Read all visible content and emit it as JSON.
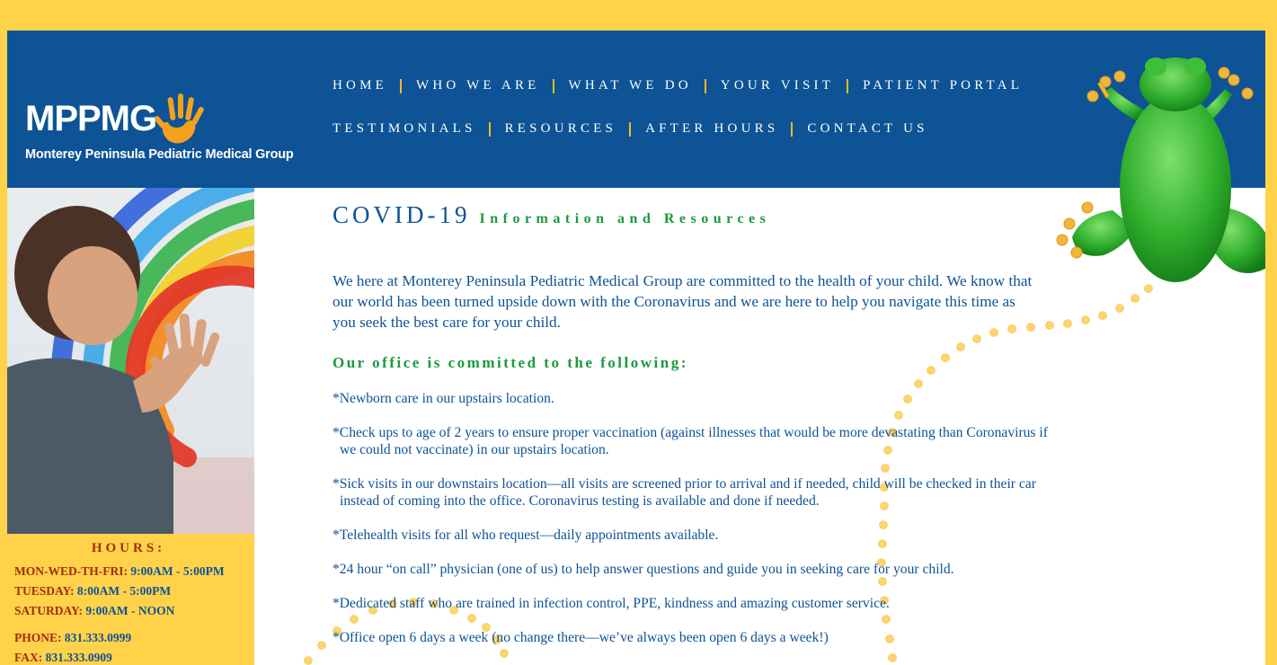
{
  "brand": {
    "logo_text": "MPPMG",
    "name": "Monterey Peninsula Pediatric Medical Group"
  },
  "nav": {
    "row1": [
      "HOME",
      "WHO WE ARE",
      "WHAT WE DO",
      "YOUR VISIT",
      "PATIENT PORTAL"
    ],
    "row2": [
      "TESTIMONIALS",
      "RESOURCES",
      "AFTER HOURS",
      "CONTACT US"
    ]
  },
  "hours": {
    "title": "HOURS:",
    "rows": [
      {
        "label": "MON-WED-TH-FRI:",
        "value": "9:00AM - 5:00PM"
      },
      {
        "label": "TUESDAY:",
        "value": "8:00AM - 5:00PM"
      },
      {
        "label": "SATURDAY:",
        "value": "9:00AM - NOON"
      }
    ],
    "phone_label": "PHONE:",
    "phone": "831.333.0999",
    "fax_label": "FAX:",
    "fax": "831.333.0909"
  },
  "content": {
    "heading_main": "COVID-19",
    "heading_sub": "Information and Resources",
    "intro": "We here at Monterey Peninsula Pediatric Medical Group are committed to the health of your child. We know that our world has been turned upside down with the Coronavirus and we are here to help you navigate this time as you seek the best care for your child.",
    "committed_heading": "Our office is committed to the following:",
    "items": [
      {
        "line1": "*Newborn care in our upstairs location.",
        "line2": ""
      },
      {
        "line1": "*Check ups to age of 2 years to ensure proper vaccination (against illnesses that would be more devastating than Coronavirus if",
        "line2": "we could not vaccinate) in our upstairs location."
      },
      {
        "line1": "*Sick visits in our downstairs location—all visits are screened prior to arrival and if needed, child will be checked in their car",
        "line2": "instead of coming into the office. Coronavirus testing is available and done if needed."
      },
      {
        "line1": "*Telehealth visits for all who request—daily appointments available.",
        "line2": ""
      },
      {
        "line1": "*24 hour “on call” physician (one of us) to help answer questions and guide you in seeking care for your child.",
        "line2": ""
      },
      {
        "line1": "*Dedicated staff who are trained in infection control, PPE, kindness and amazing customer service.",
        "line2": ""
      },
      {
        "line1": "*Office open 6 days a week (no change there—we’ve always been open 6 days a week!)",
        "line2": ""
      }
    ]
  },
  "icons": {
    "logo_hand": "hand-print-icon",
    "mascot": "tree-frog-illustration",
    "photo": "child-rainbow-photo"
  },
  "colors": {
    "page_background": "#ffd24a",
    "header_blue": "#0d5395",
    "accent_green": "#1b9a3c",
    "hours_label_red": "#a42c0c",
    "separator_gold": "#f5b920"
  }
}
